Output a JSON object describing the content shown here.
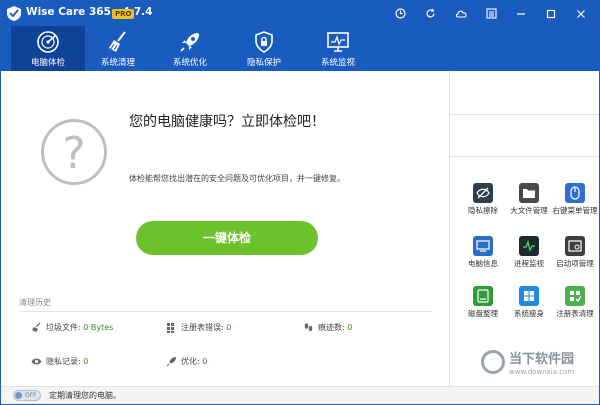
{
  "window": {
    "title": "Wise Care 365 - 4.7.4",
    "badge": "PRO"
  },
  "nav": {
    "items": [
      {
        "label": "电脑体检",
        "icon": "radar-icon",
        "active": true
      },
      {
        "label": "系统清理",
        "icon": "broom-icon",
        "active": false
      },
      {
        "label": "系统优化",
        "icon": "rocket-icon",
        "active": false
      },
      {
        "label": "隐私保护",
        "icon": "shield-icon",
        "active": false
      },
      {
        "label": "系统监视",
        "icon": "monitor-icon",
        "active": false
      }
    ]
  },
  "main": {
    "headline": "您的电脑健康吗？立即体检吧！",
    "description": "体检能帮您找出潜在的安全问题及可优化项目，并一键修复。",
    "check_button": "一键体检",
    "history_title": "清理历史",
    "stats": {
      "junk_label": "垃圾文件:",
      "junk_value": "0 Bytes",
      "registry_label": "注册表错误:",
      "registry_value": "0",
      "traces_label": "痕迹数:",
      "traces_value": "0",
      "privacy_label": "隐私记录:",
      "privacy_value": "0",
      "optimize_label": "优化:",
      "optimize_value": "0"
    }
  },
  "tools": [
    {
      "label": "隐私擦除",
      "color": "#2c3e50"
    },
    {
      "label": "大文件管理",
      "color": "#4a4a4a"
    },
    {
      "label": "右键菜单管理",
      "color": "#2f6fd1"
    },
    {
      "label": "电脑信息",
      "color": "#2b6cc4"
    },
    {
      "label": "进程监视",
      "color": "#1e2a2f"
    },
    {
      "label": "启动项管理",
      "color": "#3c3c3c"
    },
    {
      "label": "磁盘整理",
      "color": "#2f9c3a"
    },
    {
      "label": "系统瘦身",
      "color": "#1e88e5"
    },
    {
      "label": "注册表清理",
      "color": "#4caf50"
    }
  ],
  "footer": {
    "toggle_state": "OFF",
    "text": "定期清理您的电脑。"
  },
  "watermark": {
    "name": "当下软件园",
    "url": "www.downxia.com"
  },
  "colors": {
    "brand_blue": "#1a5bbf",
    "active_tab": "#0f4398",
    "check_green": "#6cc22a"
  }
}
